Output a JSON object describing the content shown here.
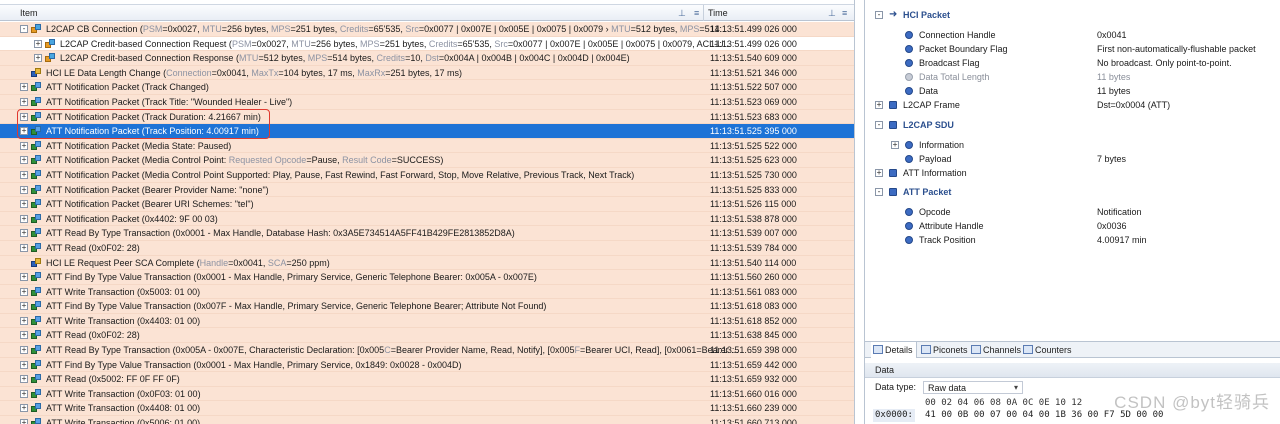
{
  "header": {
    "item_label": "Item",
    "time_label": "Time",
    "pin_icon": "pin-icon"
  },
  "rows": [
    {
      "type": "l2",
      "exp": "-",
      "indent": 0,
      "text": "L2CAP CB Connection (PSM=0x0027, MTU=256 bytes, MPS=251 bytes, Credits=65'535, Src=0x0077 | 0x007E | 0x005E | 0x0075 | 0x0079 › MTU=512 bytes, MPS=514...",
      "time": "11:13:51.499 026 000",
      "bg": "orange"
    },
    {
      "type": "l2",
      "exp": "+",
      "indent": 1,
      "text": "L2CAP Credit-based Connection Request (PSM=0x0027, MTU=256 bytes, MPS=251 bytes, Credits=65'535, Src=0x0077 | 0x007E | 0x005E | 0x0075 | 0x0079, ACL-U...",
      "time": "11:13:51.499 026 000",
      "bg": "white"
    },
    {
      "type": "l2",
      "exp": "+",
      "indent": 1,
      "text": "L2CAP Credit-based Connection Response (MTU=512 bytes, MPS=514 bytes, Credits=10, Dst=0x004A | 0x004B | 0x004C | 0x004D | 0x004E)",
      "time": "11:13:51.540 609 000",
      "bg": "orange"
    },
    {
      "type": "hci",
      "exp": "",
      "indent": 0,
      "text": "HCI LE Data Length Change (Connection=0x0041, MaxTx=104 bytes, 17 ms, MaxRx=251 bytes, 17 ms)",
      "time": "11:13:51.521 346 000",
      "bg": "orange"
    },
    {
      "type": "att",
      "exp": "+",
      "indent": 0,
      "text": "ATT Notification Packet (Track Changed)",
      "time": "11:13:51.522 507 000",
      "bg": "orange"
    },
    {
      "type": "att",
      "exp": "+",
      "indent": 0,
      "text": "ATT Notification Packet (Track Title: \"Wounded Healer - Live\")",
      "time": "11:13:51.523 069 000",
      "bg": "orange"
    },
    {
      "type": "att",
      "exp": "+",
      "indent": 0,
      "text": "ATT Notification Packet (Track Duration: 4.21667 min)",
      "time": "11:13:51.523 683 000",
      "bg": "orange"
    },
    {
      "type": "att",
      "exp": "+",
      "indent": 0,
      "text": "ATT Notification Packet (Track Position: 4.00917 min)",
      "time": "11:13:51.525 395 000",
      "bg": "selected"
    },
    {
      "type": "att",
      "exp": "+",
      "indent": 0,
      "text": "ATT Notification Packet (Media State: Paused)",
      "time": "11:13:51.525 522 000",
      "bg": "orange"
    },
    {
      "type": "att",
      "exp": "+",
      "indent": 0,
      "text": "ATT Notification Packet (Media Control Point: Requested Opcode=Pause, Result Code=SUCCESS)",
      "time": "11:13:51.525 623 000",
      "bg": "orange"
    },
    {
      "type": "att",
      "exp": "+",
      "indent": 0,
      "text": "ATT Notification Packet (Media Control Point Supported: Play, Pause, Fast Rewind, Fast Forward, Stop, Move Relative, Previous Track, Next Track)",
      "time": "11:13:51.525 730 000",
      "bg": "orange"
    },
    {
      "type": "att",
      "exp": "+",
      "indent": 0,
      "text": "ATT Notification Packet (Bearer Provider Name: \"none\")",
      "time": "11:13:51.525 833 000",
      "bg": "orange"
    },
    {
      "type": "att",
      "exp": "+",
      "indent": 0,
      "text": "ATT Notification Packet (Bearer URI Schemes: \"tel\")",
      "time": "11:13:51.526 115 000",
      "bg": "orange"
    },
    {
      "type": "att",
      "exp": "+",
      "indent": 0,
      "text": "ATT Notification Packet (0x4402: 9F 00 03)",
      "time": "11:13:51.538 878 000",
      "bg": "orange"
    },
    {
      "type": "att",
      "exp": "+",
      "indent": 0,
      "text": "ATT Read By Type Transaction (0x0001 - Max Handle, Database Hash: 0x3A5E734514A5FF41B429FE2813852D8A)",
      "time": "11:13:51.539 007 000",
      "bg": "orange"
    },
    {
      "type": "att",
      "exp": "+",
      "indent": 0,
      "text": "ATT Read (0x0F02: 28)",
      "time": "11:13:51.539 784 000",
      "bg": "orange"
    },
    {
      "type": "hci",
      "exp": "",
      "indent": 0,
      "text": "HCI LE Request Peer SCA Complete (Handle=0x0041, SCA=250 ppm)",
      "time": "11:13:51.540 114 000",
      "bg": "orange"
    },
    {
      "type": "att",
      "exp": "+",
      "indent": 0,
      "text": "ATT Find By Type Value Transaction (0x0001 - Max Handle, Primary Service, Generic Telephone Bearer: 0x005A - 0x007E)",
      "time": "11:13:51.560 260 000",
      "bg": "orange"
    },
    {
      "type": "att",
      "exp": "+",
      "indent": 0,
      "text": "ATT Write Transaction (0x5003: 01 00)",
      "time": "11:13:51.561 083 000",
      "bg": "orange"
    },
    {
      "type": "att",
      "exp": "+",
      "indent": 0,
      "text": "ATT Find By Type Value Transaction (0x007F - Max Handle, Primary Service, Generic Telephone Bearer; Attribute Not Found)",
      "time": "11:13:51.618 083 000",
      "bg": "orange"
    },
    {
      "type": "att",
      "exp": "+",
      "indent": 0,
      "text": "ATT Write Transaction (0x4403: 01 00)",
      "time": "11:13:51.618 852 000",
      "bg": "orange"
    },
    {
      "type": "att",
      "exp": "+",
      "indent": 0,
      "text": "ATT Read (0x0F02: 28)",
      "time": "11:13:51.638 845 000",
      "bg": "orange"
    },
    {
      "type": "att",
      "exp": "+",
      "indent": 0,
      "text": "ATT Read By Type Transaction (0x005A - 0x007E, Characteristic Declaration: [0x005C=Bearer Provider Name, Read, Notify], [0x005F=Bearer UCI, Read], [0x0061=Bearer ...",
      "time": "11:13:51.659 398 000",
      "bg": "orange"
    },
    {
      "type": "att",
      "exp": "+",
      "indent": 0,
      "text": "ATT Find By Type Value Transaction (0x0001 - Max Handle, Primary Service, 0x1849: 0x0028 - 0x004D)",
      "time": "11:13:51.659 442 000",
      "bg": "orange"
    },
    {
      "type": "att",
      "exp": "+",
      "indent": 0,
      "text": "ATT Read (0x5002: FF 0F FF 0F)",
      "time": "11:13:51.659 932 000",
      "bg": "orange"
    },
    {
      "type": "att",
      "exp": "+",
      "indent": 0,
      "text": "ATT Write Transaction (0x0F03: 01 00)",
      "time": "11:13:51.660 016 000",
      "bg": "orange"
    },
    {
      "type": "att",
      "exp": "+",
      "indent": 0,
      "text": "ATT Write Transaction (0x4408: 01 00)",
      "time": "11:13:51.660 239 000",
      "bg": "orange"
    },
    {
      "type": "att",
      "exp": "+",
      "indent": 0,
      "text": "ATT Write Transaction (0x5006: 01 00)",
      "time": "11:13:51.660 713 000",
      "bg": "orange"
    }
  ],
  "details": [
    {
      "kind": "section",
      "exp": "-",
      "arrow": true,
      "label": "HCI Packet",
      "val": ""
    },
    {
      "kind": "field",
      "label": "Connection Handle",
      "val": "0x0041"
    },
    {
      "kind": "field",
      "label": "Packet Boundary Flag",
      "val": "First non-automatically-flushable packet"
    },
    {
      "kind": "field",
      "label": "Broadcast Flag",
      "val": "No broadcast. Only point-to-point."
    },
    {
      "kind": "field",
      "grey": true,
      "label": "Data Total Length",
      "val": "11 bytes"
    },
    {
      "kind": "field",
      "label": "Data",
      "val": "11 bytes"
    },
    {
      "kind": "plain",
      "exp": "+",
      "label": "L2CAP Frame",
      "val": "Dst=0x0004 (ATT)"
    },
    {
      "kind": "section",
      "exp": "-",
      "label": "L2CAP SDU",
      "val": ""
    },
    {
      "kind": "subexp",
      "exp": "+",
      "label": "Information",
      "val": ""
    },
    {
      "kind": "field",
      "label": "Payload",
      "val": "7 bytes"
    },
    {
      "kind": "plain",
      "exp": "+",
      "label": "ATT Information",
      "val": ""
    },
    {
      "kind": "section",
      "exp": "-",
      "label": "ATT Packet",
      "val": ""
    },
    {
      "kind": "field",
      "label": "Opcode",
      "val": "Notification"
    },
    {
      "kind": "field",
      "label": "Attribute Handle",
      "val": "0x0036"
    },
    {
      "kind": "field",
      "label": "Track Position",
      "val": "4.00917 min"
    }
  ],
  "tabs": [
    {
      "label": "Details",
      "active": true
    },
    {
      "label": "Piconets",
      "active": false
    },
    {
      "label": "Channels",
      "active": false
    },
    {
      "label": "Counters",
      "active": false
    }
  ],
  "data_panel": {
    "title": "Data",
    "type_label": "Data type:",
    "type_value": "Raw data",
    "hex_header": "00  02  04  06  08  0A  0C  0E  10  12",
    "offset": "0x0000:",
    "bytes": "41 00 0B 00 07 00 04 00 1B 36 00 F7 5D 00 00"
  },
  "watermark": "CSDN @byt轻骑兵"
}
